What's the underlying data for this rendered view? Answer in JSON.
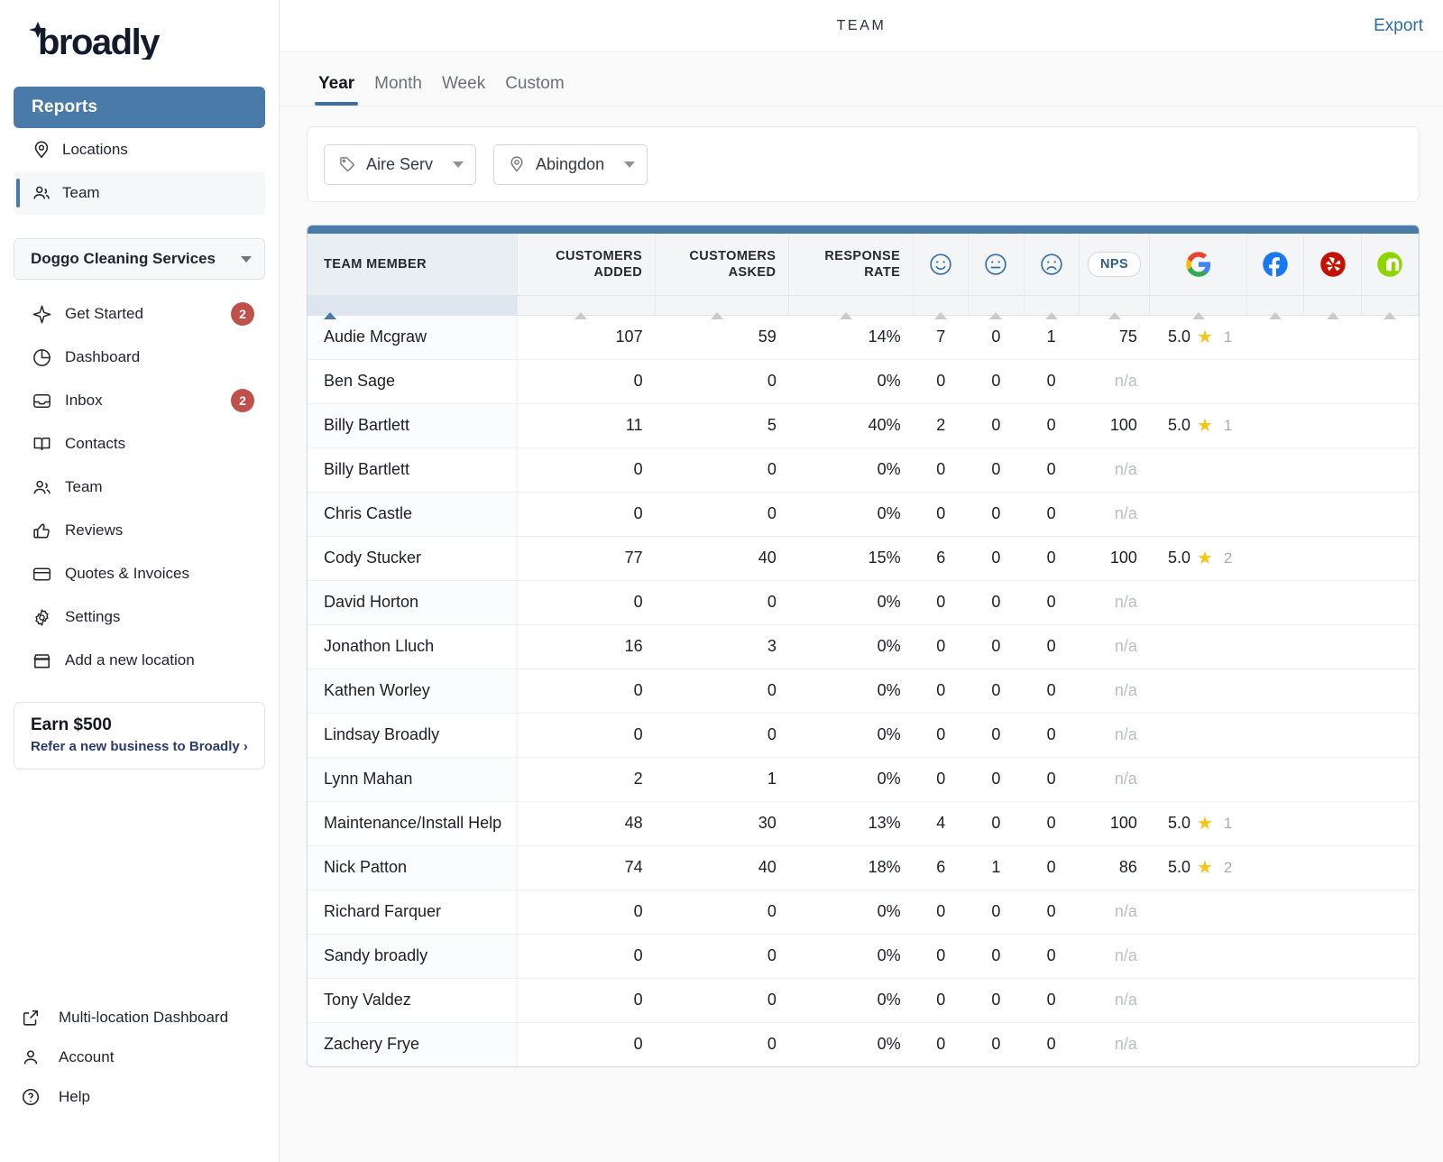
{
  "brand": {
    "name": "broadly"
  },
  "sidebar": {
    "reports_label": "Reports",
    "report_items": [
      {
        "label": "Locations",
        "icon": "map-pin-icon",
        "active": false
      },
      {
        "label": "Team",
        "icon": "users-icon",
        "active": true
      }
    ],
    "location_select": {
      "value": "Doggo Cleaning Services"
    },
    "nav_items": [
      {
        "label": "Get Started",
        "icon": "sparkle-icon",
        "badge": "2"
      },
      {
        "label": "Dashboard",
        "icon": "pie-chart-icon",
        "badge": ""
      },
      {
        "label": "Inbox",
        "icon": "inbox-icon",
        "badge": "2"
      },
      {
        "label": "Contacts",
        "icon": "book-icon",
        "badge": ""
      },
      {
        "label": "Team",
        "icon": "users-icon",
        "badge": ""
      },
      {
        "label": "Reviews",
        "icon": "thumbs-up-icon",
        "badge": ""
      },
      {
        "label": "Quotes & Invoices",
        "icon": "card-icon",
        "badge": ""
      },
      {
        "label": "Settings",
        "icon": "gear-icon",
        "badge": ""
      },
      {
        "label": "Add a new location",
        "icon": "storefront-icon",
        "badge": ""
      }
    ],
    "earn_card": {
      "title": "Earn $500",
      "link": "Refer a new business to Broadly ›"
    },
    "footer_items": [
      {
        "label": "Multi-location Dashboard",
        "icon": "external-link-icon"
      },
      {
        "label": "Account",
        "icon": "person-icon"
      },
      {
        "label": "Help",
        "icon": "question-circle-icon"
      }
    ]
  },
  "header": {
    "title": "TEAM",
    "export_label": "Export"
  },
  "tabs": [
    {
      "label": "Year",
      "active": true
    },
    {
      "label": "Month",
      "active": false
    },
    {
      "label": "Week",
      "active": false
    },
    {
      "label": "Custom",
      "active": false
    }
  ],
  "filters": [
    {
      "icon": "tag-icon",
      "value": "Aire Serv"
    },
    {
      "icon": "map-pin-icon",
      "value": "Abingdon"
    }
  ],
  "table": {
    "columns": [
      {
        "key": "member",
        "label": "TEAM MEMBER",
        "type": "text",
        "sorted": true
      },
      {
        "key": "added",
        "label": "CUSTOMERS ADDED",
        "type": "num"
      },
      {
        "key": "asked",
        "label": "CUSTOMERS ASKED",
        "type": "num"
      },
      {
        "key": "rate",
        "label": "RESPONSE RATE",
        "type": "num"
      },
      {
        "key": "happy",
        "label": "",
        "icon": "smiley-happy-icon",
        "type": "icon"
      },
      {
        "key": "neutral",
        "label": "",
        "icon": "smiley-neutral-icon",
        "type": "icon"
      },
      {
        "key": "sad",
        "label": "",
        "icon": "smiley-sad-icon",
        "type": "icon"
      },
      {
        "key": "nps",
        "label": "NPS",
        "icon": "nps-pill-icon",
        "type": "icon"
      },
      {
        "key": "google",
        "label": "",
        "icon": "google-icon",
        "type": "icon"
      },
      {
        "key": "facebook",
        "label": "",
        "icon": "facebook-icon",
        "type": "icon"
      },
      {
        "key": "yelp",
        "label": "",
        "icon": "yelp-icon",
        "type": "icon"
      },
      {
        "key": "nextdoor",
        "label": "",
        "icon": "nextdoor-icon",
        "type": "icon"
      }
    ],
    "rows": [
      {
        "member": "Audie Mcgraw",
        "added": "107",
        "asked": "59",
        "rate": "14%",
        "happy": "7",
        "neutral": "0",
        "sad": "1",
        "nps": "75",
        "google_rating": "5.0",
        "google_count": "1",
        "facebook": "",
        "yelp": "",
        "nextdoor": ""
      },
      {
        "member": "Ben Sage",
        "added": "0",
        "asked": "0",
        "rate": "0%",
        "happy": "0",
        "neutral": "0",
        "sad": "0",
        "nps": "n/a",
        "google_rating": "",
        "google_count": "",
        "facebook": "",
        "yelp": "",
        "nextdoor": ""
      },
      {
        "member": "Billy Bartlett",
        "added": "11",
        "asked": "5",
        "rate": "40%",
        "happy": "2",
        "neutral": "0",
        "sad": "0",
        "nps": "100",
        "google_rating": "5.0",
        "google_count": "1",
        "facebook": "",
        "yelp": "",
        "nextdoor": ""
      },
      {
        "member": "Billy Bartlett",
        "added": "0",
        "asked": "0",
        "rate": "0%",
        "happy": "0",
        "neutral": "0",
        "sad": "0",
        "nps": "n/a",
        "google_rating": "",
        "google_count": "",
        "facebook": "",
        "yelp": "",
        "nextdoor": ""
      },
      {
        "member": "Chris Castle",
        "added": "0",
        "asked": "0",
        "rate": "0%",
        "happy": "0",
        "neutral": "0",
        "sad": "0",
        "nps": "n/a",
        "google_rating": "",
        "google_count": "",
        "facebook": "",
        "yelp": "",
        "nextdoor": ""
      },
      {
        "member": "Cody Stucker",
        "added": "77",
        "asked": "40",
        "rate": "15%",
        "happy": "6",
        "neutral": "0",
        "sad": "0",
        "nps": "100",
        "google_rating": "5.0",
        "google_count": "2",
        "facebook": "",
        "yelp": "",
        "nextdoor": ""
      },
      {
        "member": "David Horton",
        "added": "0",
        "asked": "0",
        "rate": "0%",
        "happy": "0",
        "neutral": "0",
        "sad": "0",
        "nps": "n/a",
        "google_rating": "",
        "google_count": "",
        "facebook": "",
        "yelp": "",
        "nextdoor": ""
      },
      {
        "member": "Jonathon Lluch",
        "added": "16",
        "asked": "3",
        "rate": "0%",
        "happy": "0",
        "neutral": "0",
        "sad": "0",
        "nps": "n/a",
        "google_rating": "",
        "google_count": "",
        "facebook": "",
        "yelp": "",
        "nextdoor": ""
      },
      {
        "member": "Kathen Worley",
        "added": "0",
        "asked": "0",
        "rate": "0%",
        "happy": "0",
        "neutral": "0",
        "sad": "0",
        "nps": "n/a",
        "google_rating": "",
        "google_count": "",
        "facebook": "",
        "yelp": "",
        "nextdoor": ""
      },
      {
        "member": "Lindsay Broadly",
        "added": "0",
        "asked": "0",
        "rate": "0%",
        "happy": "0",
        "neutral": "0",
        "sad": "0",
        "nps": "n/a",
        "google_rating": "",
        "google_count": "",
        "facebook": "",
        "yelp": "",
        "nextdoor": ""
      },
      {
        "member": "Lynn Mahan",
        "added": "2",
        "asked": "1",
        "rate": "0%",
        "happy": "0",
        "neutral": "0",
        "sad": "0",
        "nps": "n/a",
        "google_rating": "",
        "google_count": "",
        "facebook": "",
        "yelp": "",
        "nextdoor": ""
      },
      {
        "member": "Maintenance/Install Help",
        "added": "48",
        "asked": "30",
        "rate": "13%",
        "happy": "4",
        "neutral": "0",
        "sad": "0",
        "nps": "100",
        "google_rating": "5.0",
        "google_count": "1",
        "facebook": "",
        "yelp": "",
        "nextdoor": ""
      },
      {
        "member": "Nick Patton",
        "added": "74",
        "asked": "40",
        "rate": "18%",
        "happy": "6",
        "neutral": "1",
        "sad": "0",
        "nps": "86",
        "google_rating": "5.0",
        "google_count": "2",
        "facebook": "",
        "yelp": "",
        "nextdoor": ""
      },
      {
        "member": "Richard Farquer",
        "added": "0",
        "asked": "0",
        "rate": "0%",
        "happy": "0",
        "neutral": "0",
        "sad": "0",
        "nps": "n/a",
        "google_rating": "",
        "google_count": "",
        "facebook": "",
        "yelp": "",
        "nextdoor": ""
      },
      {
        "member": "Sandy broadly",
        "added": "0",
        "asked": "0",
        "rate": "0%",
        "happy": "0",
        "neutral": "0",
        "sad": "0",
        "nps": "n/a",
        "google_rating": "",
        "google_count": "",
        "facebook": "",
        "yelp": "",
        "nextdoor": ""
      },
      {
        "member": "Tony Valdez",
        "added": "0",
        "asked": "0",
        "rate": "0%",
        "happy": "0",
        "neutral": "0",
        "sad": "0",
        "nps": "n/a",
        "google_rating": "",
        "google_count": "",
        "facebook": "",
        "yelp": "",
        "nextdoor": ""
      },
      {
        "member": "Zachery Frye",
        "added": "0",
        "asked": "0",
        "rate": "0%",
        "happy": "0",
        "neutral": "0",
        "sad": "0",
        "nps": "n/a",
        "google_rating": "",
        "google_count": "",
        "facebook": "",
        "yelp": "",
        "nextdoor": ""
      }
    ]
  },
  "colors": {
    "brand_blue": "#4a7aa7",
    "accent_link": "#2b6ca3",
    "badge_red": "#c0504a",
    "star_yellow": "#f5c518",
    "google_blue": "#4285f4",
    "facebook_blue": "#1877f2",
    "yelp_red": "#c41200",
    "nextdoor_green": "#8ed500"
  }
}
